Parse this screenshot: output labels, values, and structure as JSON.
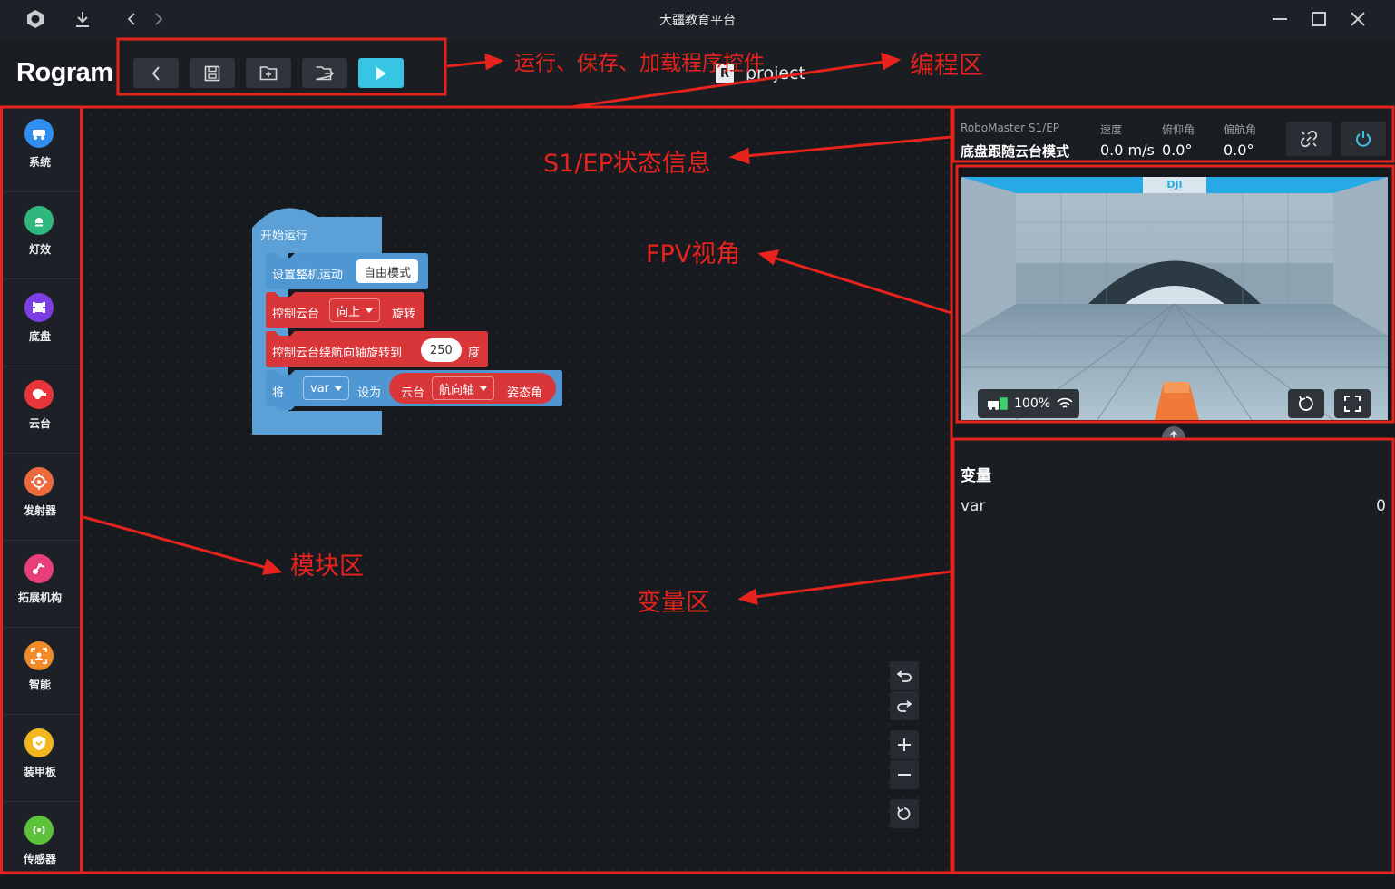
{
  "window": {
    "title": "大疆教育平台"
  },
  "header": {
    "app_title": "Rogram",
    "project_name": "project",
    "project_icon": "R"
  },
  "sidebar": {
    "items": [
      {
        "label": "系统",
        "color": "#2e8ff0",
        "icon": "system-icon"
      },
      {
        "label": "灯效",
        "color": "#2fb77d",
        "icon": "light-icon"
      },
      {
        "label": "底盘",
        "color": "#7b3fe4",
        "icon": "chassis-icon"
      },
      {
        "label": "云台",
        "color": "#e8353b",
        "icon": "gimbal-icon"
      },
      {
        "label": "发射器",
        "color": "#ee6a3c",
        "icon": "blaster-icon"
      },
      {
        "label": "拓展机构",
        "color": "#e83e7a",
        "icon": "extension-icon"
      },
      {
        "label": "智能",
        "color": "#f08a2a",
        "icon": "smart-icon"
      },
      {
        "label": "装甲板",
        "color": "#f0b81e",
        "icon": "armor-icon"
      },
      {
        "label": "传感器",
        "color": "#5cc23a",
        "icon": "sensor-icon"
      }
    ]
  },
  "blocks": {
    "start": "开始运行",
    "set_mode": {
      "label": "设置整机运动",
      "value": "自由模式"
    },
    "gimbal_rotate": {
      "label": "控制云台",
      "direction": "向上",
      "suffix": "旋转"
    },
    "gimbal_yaw": {
      "label": "控制云台绕航向轴旋转到",
      "value": "250",
      "suffix": "度"
    },
    "set_var": {
      "label": "将",
      "var": "var",
      "set": "设为",
      "source": "云台",
      "axis": "航向轴",
      "suffix": "姿态角"
    }
  },
  "status": {
    "device": "RoboMaster S1/EP",
    "mode": "底盘跟随云台模式",
    "speed_label": "速度",
    "speed": "0.0 m/s",
    "pitch_label": "俯仰角",
    "pitch": "0.0°",
    "yaw_label": "偏航角",
    "yaw": "0.0°"
  },
  "fpv": {
    "battery": "100%",
    "sign": "DJI"
  },
  "variables": {
    "title": "变量",
    "items": [
      {
        "name": "var",
        "value": "0"
      }
    ]
  },
  "annotations": {
    "controls": "运行、保存、加载程序控件",
    "programming": "编程区",
    "status": "S1/EP状态信息",
    "fpv": "FPV视角",
    "modules": "模块区",
    "variables": "变量区"
  },
  "colors": {
    "accent": "#38c4e3",
    "annotation": "#e6231d",
    "event_block": "#5ba0d6",
    "gimbal_block": "#d9363a"
  }
}
